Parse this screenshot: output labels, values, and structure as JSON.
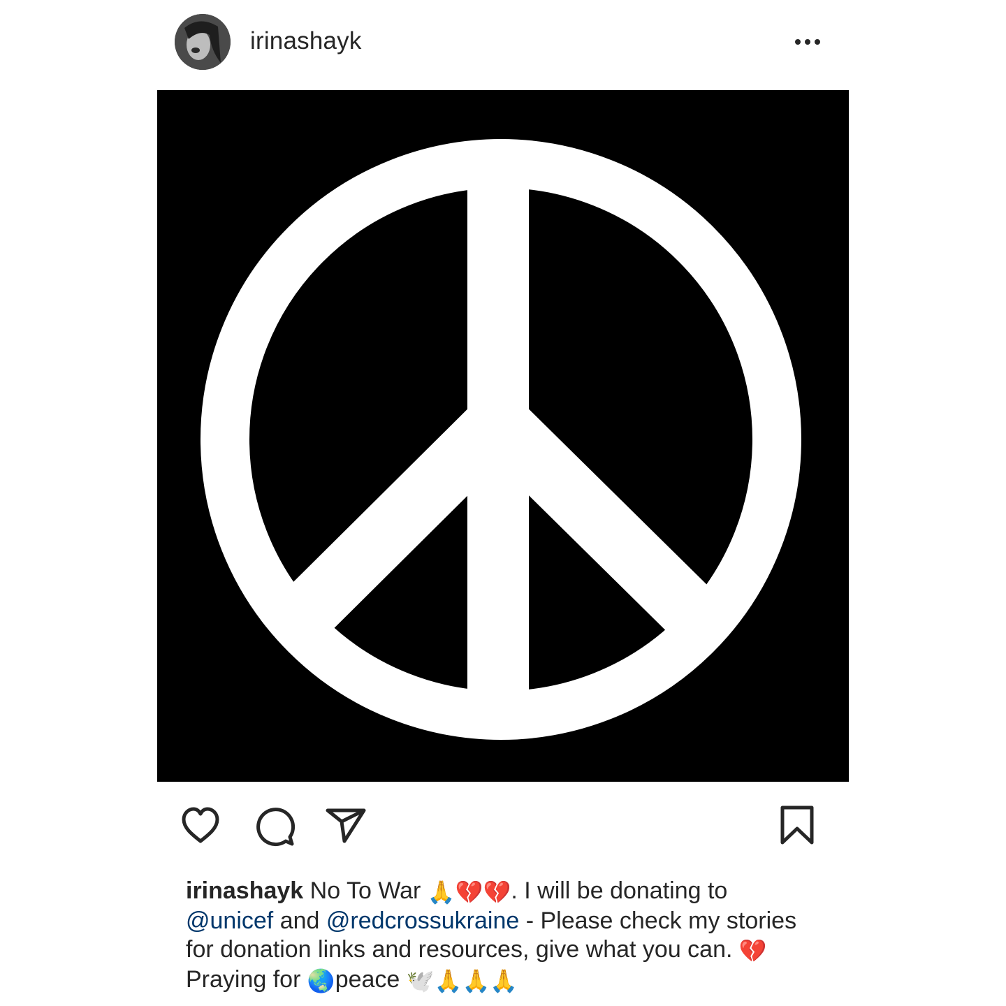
{
  "post": {
    "username": "irinashayk",
    "more_label": "...",
    "image_icon": "peace-sign",
    "caption": {
      "user": "irinashayk",
      "text_1": " No To War ",
      "emoji_1": "🙏💔💔",
      "text_2": ". I will be donating to",
      "mention_1": "@unicef",
      "text_3": " and ",
      "mention_2": "@redcrossukraine",
      "text_4": " - Please check my stories for donation links and resources, give what you can. ",
      "emoji_2": "💔",
      "text_5": " Praying for ",
      "emoji_3": "🌏",
      "text_6": "peace ",
      "emoji_4": "🕊️🙏🙏🙏"
    }
  },
  "actions": {
    "like_icon": "heart-icon",
    "comment_icon": "comment-icon",
    "share_icon": "send-icon",
    "save_icon": "bookmark-icon"
  },
  "colors": {
    "text": "#262626",
    "mention": "#00376b",
    "image_background": "#000000",
    "peace_sign": "#ffffff"
  }
}
